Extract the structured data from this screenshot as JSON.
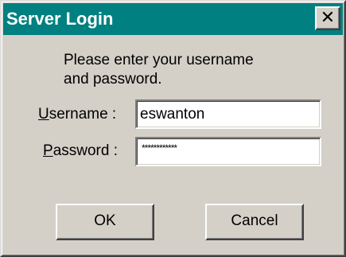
{
  "window": {
    "title": "Server Login",
    "close_label": "✕"
  },
  "message": {
    "line1": "Please enter your username",
    "line2": "and password."
  },
  "fields": {
    "username": {
      "label_accel": "U",
      "label_rest": "sername :",
      "value": "eswanton"
    },
    "password": {
      "label_accel": "P",
      "label_rest": "assword :",
      "masked_value": "************"
    }
  },
  "buttons": {
    "ok_label": "OK",
    "cancel_label": "Cancel"
  },
  "colors": {
    "titlebar": "#008080",
    "face": "#d4d0c8"
  },
  "icons": {
    "close": "close-icon"
  }
}
